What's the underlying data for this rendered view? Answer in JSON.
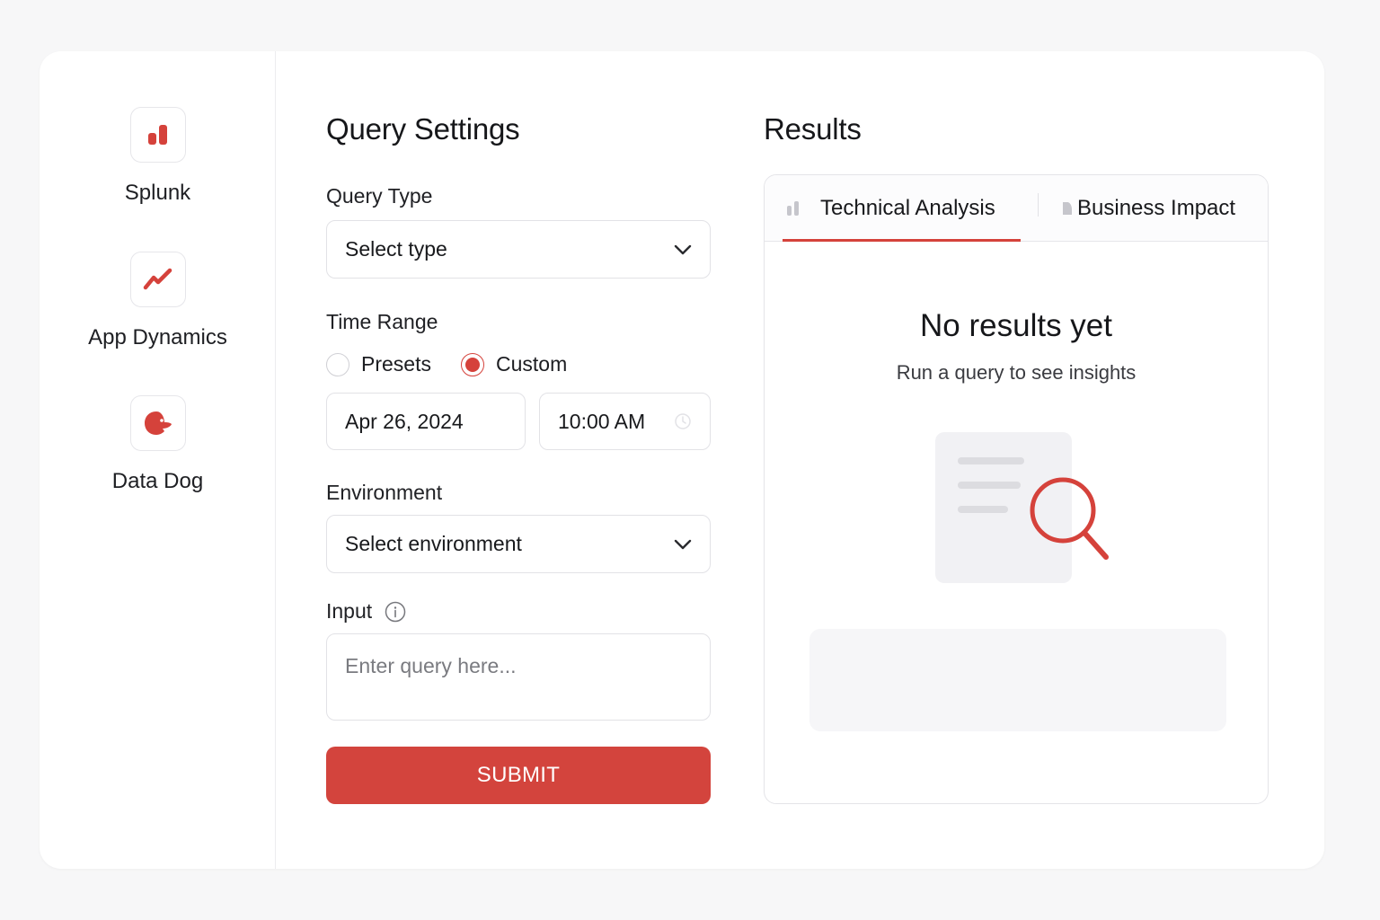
{
  "colors": {
    "accent": "#d3443d",
    "background": "#f7f7f8",
    "card": "#ffffff"
  },
  "sidebar": {
    "items": [
      {
        "label": "Splunk",
        "icon": "bar-chart-icon"
      },
      {
        "label": "App Dynamics",
        "icon": "trend-line-icon"
      },
      {
        "label": "Data Dog",
        "icon": "dog-head-icon"
      }
    ]
  },
  "settings": {
    "title": "Query Settings",
    "query_type": {
      "label": "Query Type",
      "value": "Select type"
    },
    "time_range": {
      "label": "Time Range",
      "options": [
        "Presets",
        "Custom"
      ],
      "selected": "Custom",
      "date": "Apr 26, 2024",
      "time": "10:00 AM"
    },
    "environment": {
      "label": "Environment",
      "value": "Select environment"
    },
    "input": {
      "label": "Input",
      "placeholder": "Enter query here..."
    },
    "submit_label": "SUBMIT"
  },
  "results": {
    "title": "Results",
    "tabs": [
      {
        "label": "Technical Analysis",
        "active": true
      },
      {
        "label": "Business Impact",
        "active": false
      }
    ],
    "empty_title": "No results yet",
    "empty_subtitle": "Run a query to see insights"
  }
}
